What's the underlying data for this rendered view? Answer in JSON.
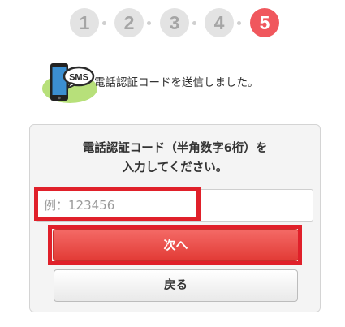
{
  "steps": {
    "items": [
      "1",
      "2",
      "3",
      "4",
      "5"
    ],
    "active_index": 4
  },
  "notice": {
    "icon": "sms-phone-icon",
    "icon_badge": "SMS",
    "text": "電話認証コードを送信しました。"
  },
  "form": {
    "instruction_line1": "電話認証コード（半角数字6桁）を",
    "instruction_line2": "入力してください。",
    "code_placeholder": "例：123456",
    "next_label": "次へ",
    "back_label": "戻る"
  },
  "colors": {
    "accent": "#f0575d",
    "highlight": "#e0202a",
    "button_red": "#e23b36"
  }
}
